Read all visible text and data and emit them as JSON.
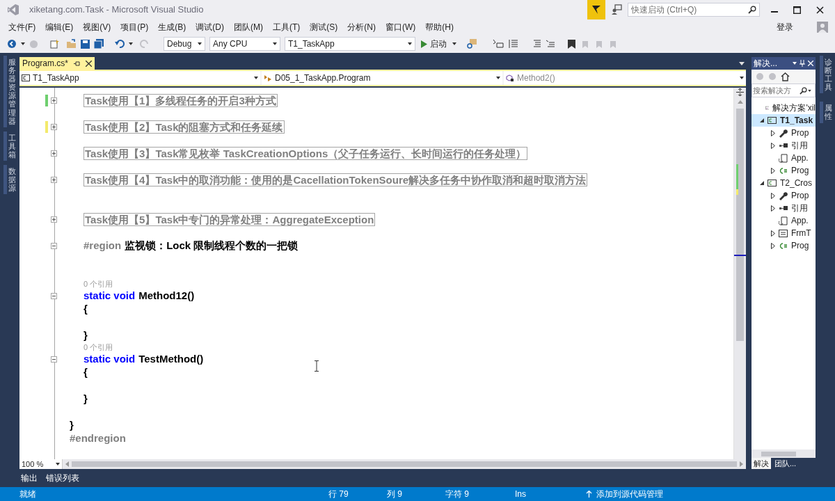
{
  "window": {
    "title": "xiketang.com.Task - Microsoft Visual Studio"
  },
  "quick_launch": {
    "placeholder": "快速启动 (Ctrl+Q)"
  },
  "menu": [
    "文件(F)",
    "编辑(E)",
    "视图(V)",
    "项目(P)",
    "生成(B)",
    "调试(D)",
    "团队(M)",
    "工具(T)",
    "测试(S)",
    "分析(N)",
    "窗口(W)",
    "帮助(H)"
  ],
  "sign_in": "登录",
  "toolbar": {
    "configuration": "Debug",
    "platform": "Any CPU",
    "startup_project": "T1_TaskApp",
    "start": "启动"
  },
  "left_tool_tabs": [
    "服务器资源管理器",
    "工具箱",
    "数据源"
  ],
  "document_tabs": [
    {
      "label": "Program.cs*",
      "selected": true
    }
  ],
  "navigation": {
    "project": "T1_TaskApp",
    "type": "D05_1_TaskApp.Program",
    "member": "Method2()"
  },
  "code_lines": [
    {
      "children": [
        {
          "kind": "region",
          "collapsed": true,
          "color": "#6fcf6f",
          "text": "Task使用【1】多线程任务的开启3种方式"
        },
        {
          "kind": "blank"
        },
        {
          "kind": "region",
          "collapsed": true,
          "color": "#f3ea6c",
          "text": "Task使用【2】Task的阻塞方式和任务延续"
        },
        {
          "kind": "blank"
        },
        {
          "kind": "region",
          "collapsed": true,
          "text": "Task使用【3】Task常见枚举 TaskCreationOptions（父子任务运行、长时间运行的任务处理）"
        },
        {
          "kind": "blank"
        },
        {
          "kind": "region",
          "collapsed": true,
          "text": "Task使用【4】Task中的取消功能：使用的是CacellationTokenSoure解决多任务中协作取消和超时取消方法"
        },
        {
          "kind": "blank"
        },
        {
          "kind": "blank"
        },
        {
          "kind": "region",
          "collapsed": true,
          "text": "Task使用【5】Task中专门的异常处理：AggregateException"
        },
        {
          "kind": "blank"
        },
        {
          "kind": "code",
          "collapsed": false,
          "tokens": [
            {
              "kind": "directive",
              "text": "#region"
            },
            {
              "kind": "plain",
              "text": "监视锁：Lock  限制线程个数的一把锁"
            }
          ]
        },
        {
          "kind": "blank"
        },
        {
          "kind": "blank"
        },
        {
          "kind": "codelens",
          "text": "0 个引用"
        },
        {
          "kind": "code",
          "collapsed": false,
          "tokens": [
            {
              "kind": "keyword",
              "text": "static void"
            },
            {
              "kind": "plain",
              "text": "Method12()"
            }
          ]
        },
        {
          "kind": "code",
          "tokens": [
            {
              "kind": "plain",
              "text": "{"
            }
          ]
        },
        {
          "kind": "blank"
        },
        {
          "kind": "code",
          "tokens": [
            {
              "kind": "plain",
              "text": "}"
            }
          ]
        },
        {
          "kind": "codelens",
          "text": "0 个引用"
        },
        {
          "kind": "code",
          "collapsed": false,
          "tokens": [
            {
              "kind": "keyword",
              "text": "static void"
            },
            {
              "kind": "plain",
              "text": "TestMethod()"
            }
          ]
        },
        {
          "kind": "code",
          "tokens": [
            {
              "kind": "plain",
              "text": "{"
            }
          ]
        },
        {
          "kind": "blank"
        },
        {
          "kind": "code",
          "tokens": [
            {
              "kind": "plain",
              "text": "}"
            }
          ]
        },
        {
          "kind": "blank"
        }
      ]
    },
    {
      "kind": "code",
      "tokens": [
        {
          "kind": "plain",
          "text": "}"
        }
      ]
    },
    {
      "kind": "code",
      "tokens": [
        {
          "kind": "directive",
          "text": "#endregion"
        }
      ]
    }
  ],
  "zoom": "100 %",
  "solution_explorer": {
    "title": "解决...",
    "search": {
      "placeholder": "搜索解决方"
    },
    "tree": [
      {
        "label": "解决方案'xil",
        "kind": "solution",
        "selected": false
      },
      {
        "label": "T1_Task",
        "kind": "project",
        "expanded": true,
        "selected": true,
        "children": [
          {
            "label": "Prop",
            "kind": "properties",
            "expanded": false,
            "selected": false
          },
          {
            "label": "引用",
            "kind": "references",
            "expanded": false,
            "selected": false
          },
          {
            "label": "App.",
            "kind": "config",
            "selected": false
          },
          {
            "label": "Prog",
            "kind": "csharp",
            "expanded": false,
            "selected": false
          }
        ]
      },
      {
        "label": "T2_Cros",
        "kind": "project",
        "expanded": true,
        "selected": false,
        "children": [
          {
            "label": "Prop",
            "kind": "properties",
            "expanded": false,
            "selected": false
          },
          {
            "label": "引用",
            "kind": "references",
            "expanded": false,
            "selected": false
          },
          {
            "label": "App.",
            "kind": "config",
            "selected": false
          },
          {
            "label": "FrmT",
            "kind": "form",
            "expanded": false,
            "selected": false
          },
          {
            "label": "Prog",
            "kind": "csharp",
            "expanded": false,
            "selected": false
          }
        ]
      }
    ],
    "tabs": [
      {
        "label": "解决",
        "selected": true
      },
      {
        "label": "团队...",
        "selected": false
      }
    ]
  },
  "right_tool_tabs": [
    "诊断工具",
    "属性"
  ],
  "bottom_tabs": [
    "输出",
    "错误列表"
  ],
  "status_bar": {
    "message": "就绪",
    "line": "行 79",
    "column": "列 9",
    "char": "字符 9",
    "mode": "Ins",
    "source_control": "添加到源代码管理"
  }
}
